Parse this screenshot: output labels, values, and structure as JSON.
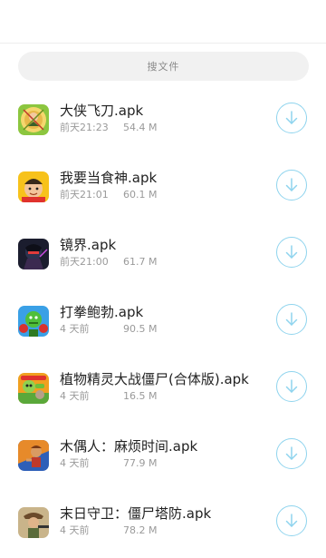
{
  "search": {
    "placeholder": "搜文件"
  },
  "files": [
    {
      "name": "大侠飞刀.apk",
      "date": "前天21:23",
      "size": "54.4 M",
      "icon": "app-icon-dart-hero"
    },
    {
      "name": "我要当食神.apk",
      "date": "前天21:01",
      "size": "60.1 M",
      "icon": "app-icon-chef"
    },
    {
      "name": "镜界.apk",
      "date": "前天21:00",
      "size": "61.7 M",
      "icon": "app-icon-mirror-realm"
    },
    {
      "name": "打拳鲍勃.apk",
      "date": "4 天前",
      "size": "90.5 M",
      "icon": "app-icon-punch-bob"
    },
    {
      "name": "植物精灵大战僵尸(合体版).apk",
      "date": "4 天前",
      "size": "16.5 M",
      "icon": "app-icon-plants-zombies"
    },
    {
      "name": "木偶人：麻烦时间.apk",
      "date": "4 天前",
      "size": "77.9 M",
      "icon": "app-icon-puppet"
    },
    {
      "name": "末日守卫：僵尸塔防.apk",
      "date": "4 天前",
      "size": "78.2 M",
      "icon": "app-icon-doomsday-guard"
    }
  ],
  "icons": {
    "download": "download-arrow-icon"
  },
  "colors": {
    "accent": "#8fd4ee",
    "search_bg": "#f1f1f1",
    "secondary_text": "#9a9a9a"
  }
}
